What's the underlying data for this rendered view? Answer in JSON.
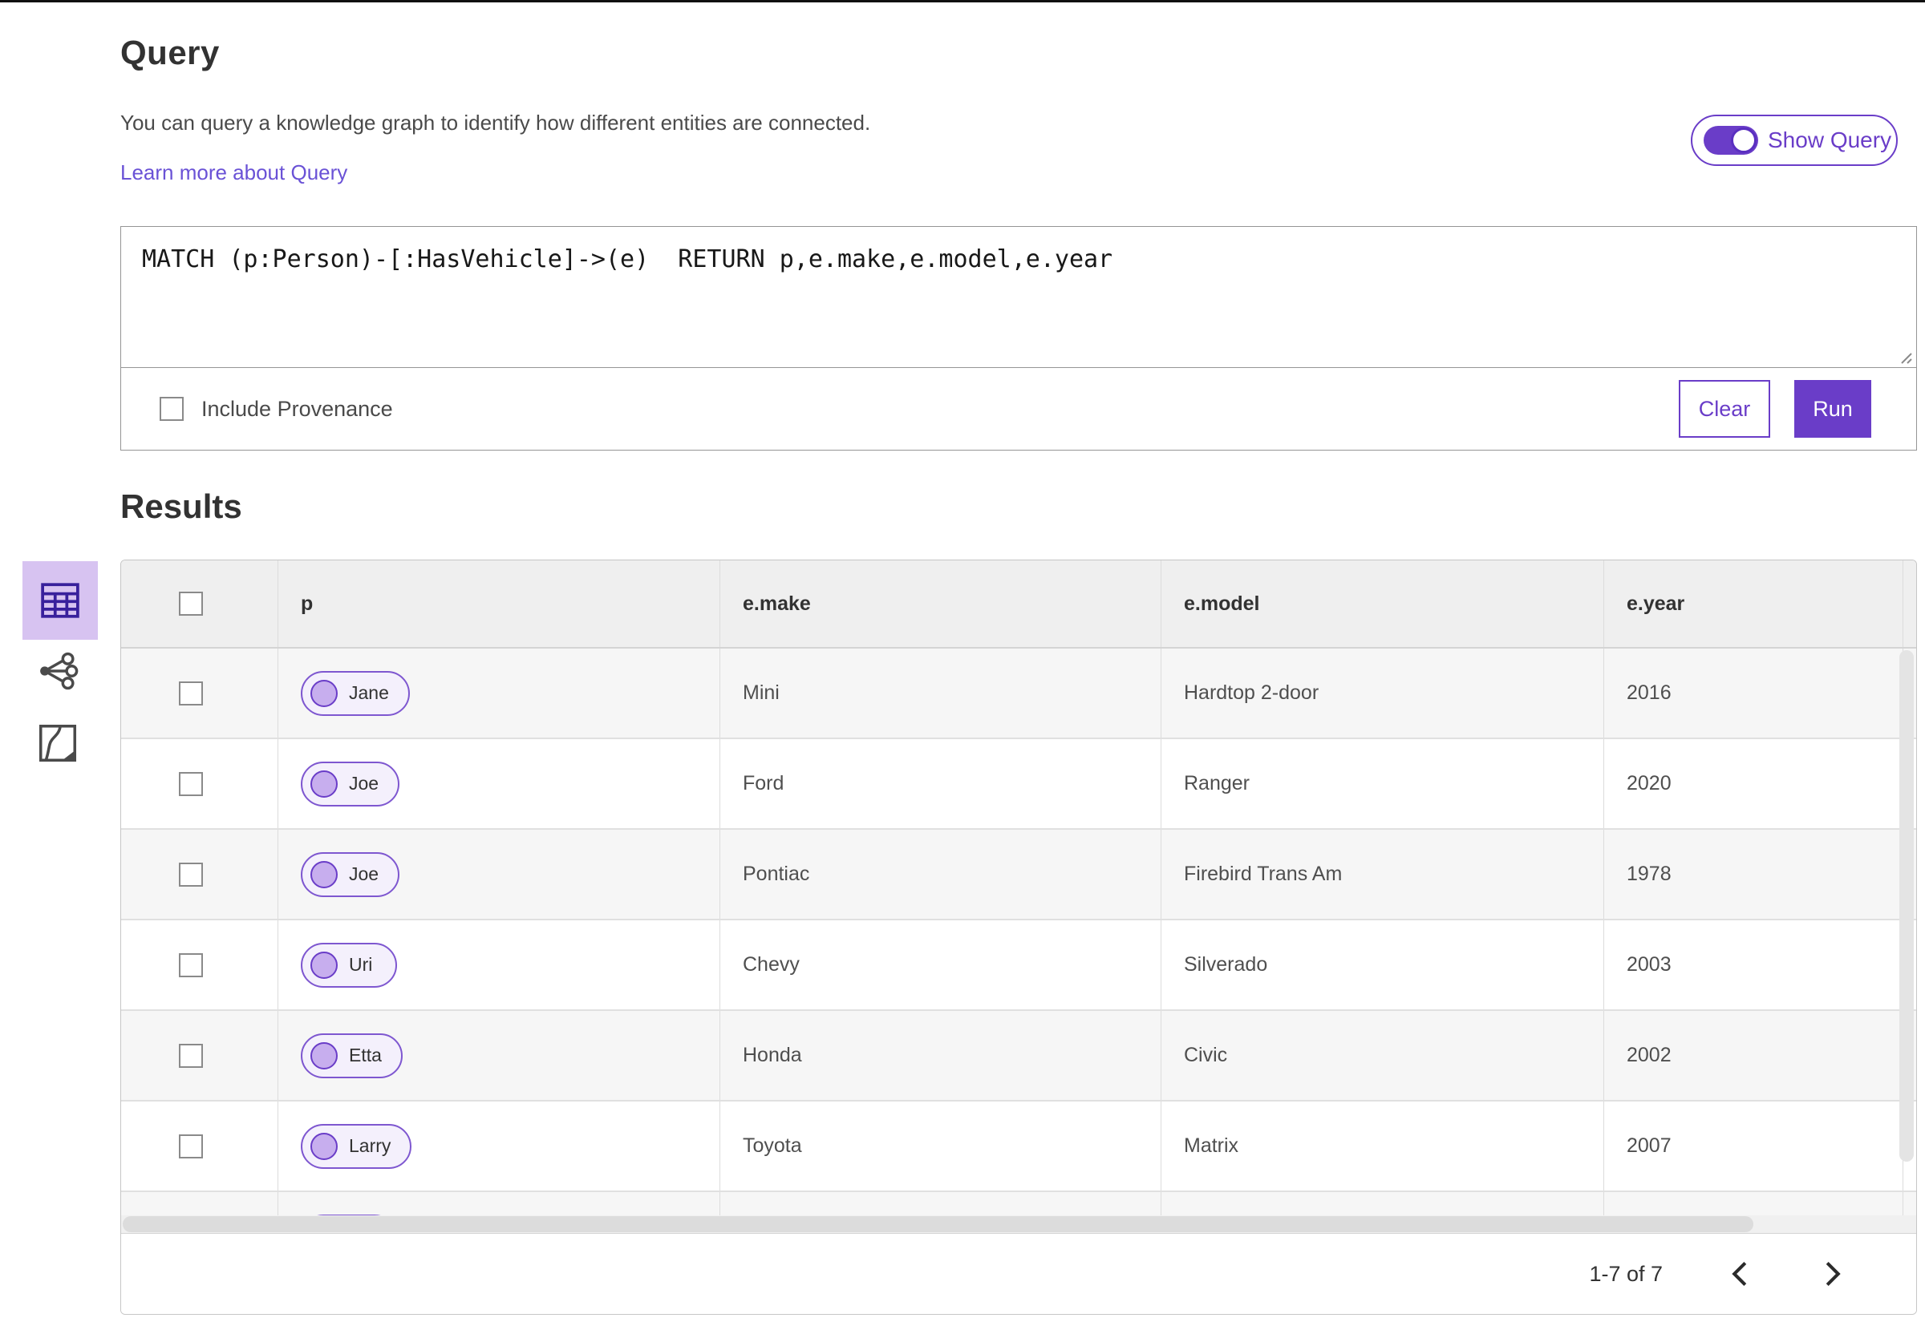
{
  "header": {
    "title": "Query",
    "description": "You can query a knowledge graph to identify how different entities are connected.",
    "learn_more_label": "Learn more about Query",
    "show_query_label": "Show Query",
    "show_query_on": true
  },
  "query_editor": {
    "query_text": "MATCH (p:Person)-[:HasVehicle]->(e)  RETURN p,e.make,e.model,e.year",
    "include_provenance_label": "Include Provenance",
    "include_provenance_checked": false,
    "clear_label": "Clear",
    "run_label": "Run"
  },
  "results": {
    "heading": "Results",
    "views": [
      {
        "name": "table-view",
        "selected": true
      },
      {
        "name": "link-chart-view",
        "selected": false
      },
      {
        "name": "map-view",
        "selected": false
      }
    ],
    "columns": {
      "p": "p",
      "make": "e.make",
      "model": "e.model",
      "year": "e.year"
    },
    "rows": [
      {
        "p": "Jane",
        "make": "Mini",
        "model": "Hardtop 2-door",
        "year": "2016"
      },
      {
        "p": "Joe",
        "make": "Ford",
        "model": "Ranger",
        "year": "2020"
      },
      {
        "p": "Joe",
        "make": "Pontiac",
        "model": "Firebird Trans Am",
        "year": "1978"
      },
      {
        "p": "Uri",
        "make": "Chevy",
        "model": "Silverado",
        "year": "2003"
      },
      {
        "p": "Etta",
        "make": "Honda",
        "model": "Civic",
        "year": "2002"
      },
      {
        "p": "Larry",
        "make": "Toyota",
        "model": "Matrix",
        "year": "2007"
      },
      {
        "p": "",
        "make": "",
        "model": "",
        "year": "",
        "partially_visible": true
      }
    ],
    "pagination": {
      "range_label": "1-7 of 7"
    }
  },
  "colors": {
    "brand_purple": "#6a3dc8",
    "link_purple": "#6a52d6",
    "selected_view_bg": "#d7c3f1",
    "pill_border": "#7e57d0",
    "pill_fill": "#f4f0fc",
    "header_row_bg": "#efefef",
    "alt_row_bg": "#f6f6f6"
  }
}
